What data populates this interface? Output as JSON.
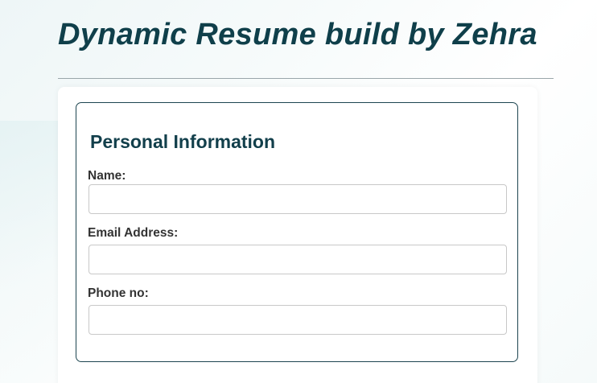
{
  "header": {
    "title": "Dynamic Resume build by Zehra"
  },
  "personal_info": {
    "heading": "Personal Information",
    "fields": [
      {
        "label": "Name:",
        "value": "",
        "placeholder": ""
      },
      {
        "label": "Email Address:",
        "value": "",
        "placeholder": ""
      },
      {
        "label": "Phone no:",
        "value": "",
        "placeholder": ""
      }
    ]
  },
  "colors": {
    "title": "#0f3f4a",
    "section_border": "#1d4550",
    "label": "#333333",
    "input_border": "#c8c8c8"
  }
}
